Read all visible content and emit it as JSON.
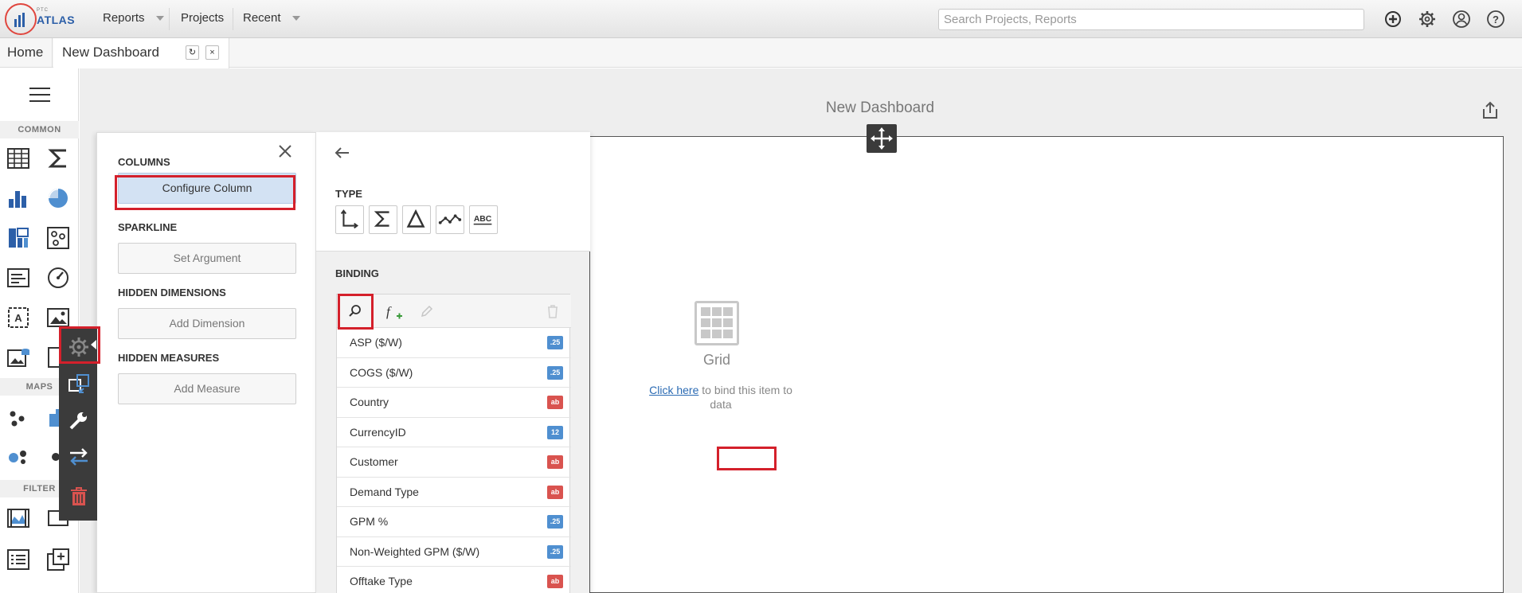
{
  "header": {
    "logo_small": "PTC",
    "logo_text": "ATLAS",
    "menus": [
      {
        "label": "Reports",
        "has_caret": true
      },
      {
        "label": "Projects",
        "has_caret": false
      },
      {
        "label": "Recent",
        "has_caret": true
      }
    ],
    "search_placeholder": "Search Projects, Reports",
    "icons": [
      "add-icon",
      "gear-icon",
      "user-icon",
      "help-icon"
    ]
  },
  "tabs": {
    "home": "Home",
    "active": "New Dashboard",
    "refresh_glyph": "↻",
    "close_glyph": "×"
  },
  "toolbox": {
    "sections": [
      "COMMON",
      "MAPS",
      "FILTER"
    ]
  },
  "dashboard": {
    "title": "New Dashboard",
    "placeholder_label": "Grid",
    "bind_link": "Click here",
    "bind_text": "to bind this item to data"
  },
  "column_panel": {
    "columns_label": "COLUMNS",
    "configure_column": "Configure Column",
    "sparkline_label": "SPARKLINE",
    "set_argument": "Set Argument",
    "hidden_dimensions_label": "HIDDEN DIMENSIONS",
    "add_dimension": "Add Dimension",
    "hidden_measures_label": "HIDDEN MEASURES",
    "add_measure": "Add Measure"
  },
  "binding_panel": {
    "type_label": "TYPE",
    "type_buttons": [
      "dimension-icon",
      "sum-icon",
      "delta-icon",
      "sparkline-icon",
      "abc-icon"
    ],
    "abc_text": "ABC",
    "binding_label": "BINDING",
    "fields": [
      {
        "name": "ASP ($/W)",
        "type": ".25"
      },
      {
        "name": "COGS ($/W)",
        "type": ".25"
      },
      {
        "name": "Country",
        "type": "ab"
      },
      {
        "name": "CurrencyID",
        "type": "12"
      },
      {
        "name": "Customer",
        "type": "ab"
      },
      {
        "name": "Demand Type",
        "type": "ab"
      },
      {
        "name": "GPM %",
        "type": ".25"
      },
      {
        "name": "Non-Weighted GPM ($/W)",
        "type": ".25"
      },
      {
        "name": "Offtake Type",
        "type": "ab"
      }
    ]
  },
  "colors": {
    "highlight": "#d4202b",
    "accent_blue": "#4f8fd0",
    "badge_red": "#d9534f",
    "floatbar": "#3b3b3b"
  }
}
